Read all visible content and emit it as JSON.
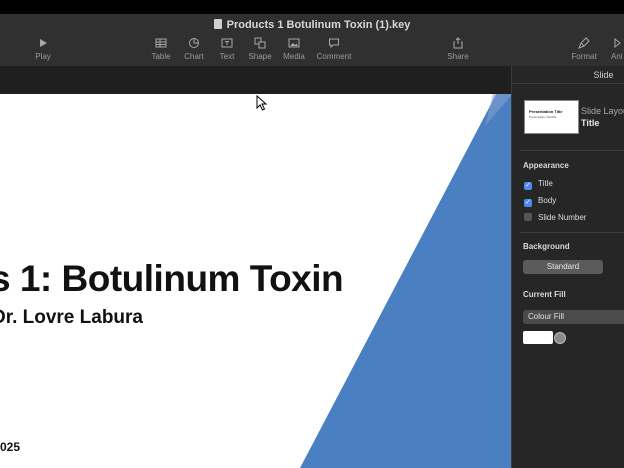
{
  "window": {
    "title": "Products 1 Botulinum Toxin (1).key"
  },
  "toolbar": {
    "play": "Play",
    "table": "Table",
    "chart": "Chart",
    "text": "Text",
    "shape": "Shape",
    "media": "Media",
    "comment": "Comment",
    "share": "Share",
    "format": "Format",
    "animate": "Ani"
  },
  "slide": {
    "title": "s 1: Botulinum Toxin",
    "subtitle": "Dr. Lovre Labura",
    "year": "025",
    "accent_color": "#4a7fc1"
  },
  "inspector": {
    "tab": "Slide",
    "layout_label": "Slide Layou",
    "layout_value": "Title",
    "thumb_title": "Presentation Title",
    "thumb_sub": "Presentation Subtitle",
    "appearance_heading": "Appearance",
    "title_checkbox": "Title",
    "body_checkbox": "Body",
    "slide_number_checkbox": "Slide Number",
    "background_heading": "Background",
    "background_button": "Standard",
    "current_fill_heading": "Current Fill",
    "fill_type": "Colour Fill"
  }
}
